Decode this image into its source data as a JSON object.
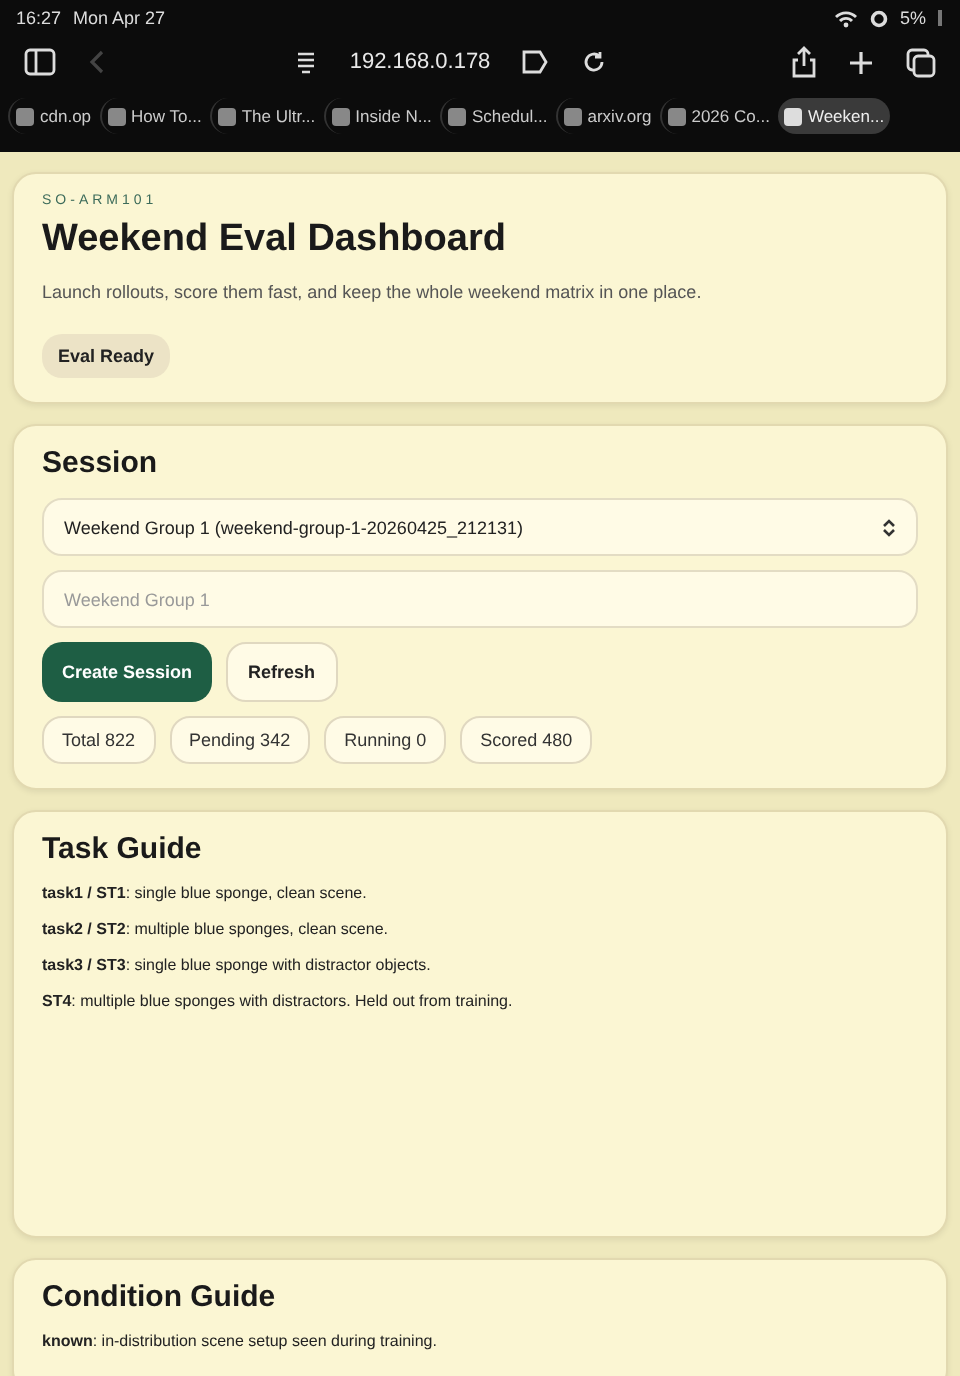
{
  "status_bar": {
    "time": "16:27",
    "date": "Mon Apr 27",
    "battery": "5%"
  },
  "browser": {
    "address": "192.168.0.178",
    "tabs": [
      {
        "title": "cdn.op",
        "selected": false
      },
      {
        "title": "How To...",
        "selected": false
      },
      {
        "title": "The Ultr...",
        "selected": false
      },
      {
        "title": "Inside N...",
        "selected": false
      },
      {
        "title": "Schedul...",
        "selected": false
      },
      {
        "title": "arxiv.org",
        "selected": false
      },
      {
        "title": "2026 Co...",
        "selected": false
      },
      {
        "title": "Weeken...",
        "selected": true
      }
    ]
  },
  "header": {
    "eyebrow": "SO-ARM101",
    "title": "Weekend Eval Dashboard",
    "subtitle": "Launch rollouts, score them fast, and keep the whole weekend matrix in one place.",
    "badge": "Eval Ready"
  },
  "session": {
    "heading": "Session",
    "select_value": "Weekend Group 1 (weekend-group-1-20260425_212131)",
    "name_placeholder": "Weekend Group 1",
    "buttons": [
      {
        "label": "Create Session",
        "kind": "primary"
      },
      {
        "label": "Refresh",
        "kind": "secondary"
      }
    ],
    "stats": [
      "Total 822",
      "Pending 342",
      "Running 0",
      "Scored 480"
    ]
  },
  "task_guide": {
    "heading": "Task Guide",
    "items": [
      "**task1 / ST1**: single blue sponge, clean scene.",
      "**task2 / ST2**: multiple blue sponges, clean scene.",
      "**task3 / ST3**: single blue sponge with distractor objects.",
      "**ST4**: multiple blue sponges with distractors. Held out from training."
    ]
  },
  "condition_guide": {
    "heading": "Condition Guide",
    "items": [
      "**known**: in-distribution scene setup seen during training."
    ]
  }
}
